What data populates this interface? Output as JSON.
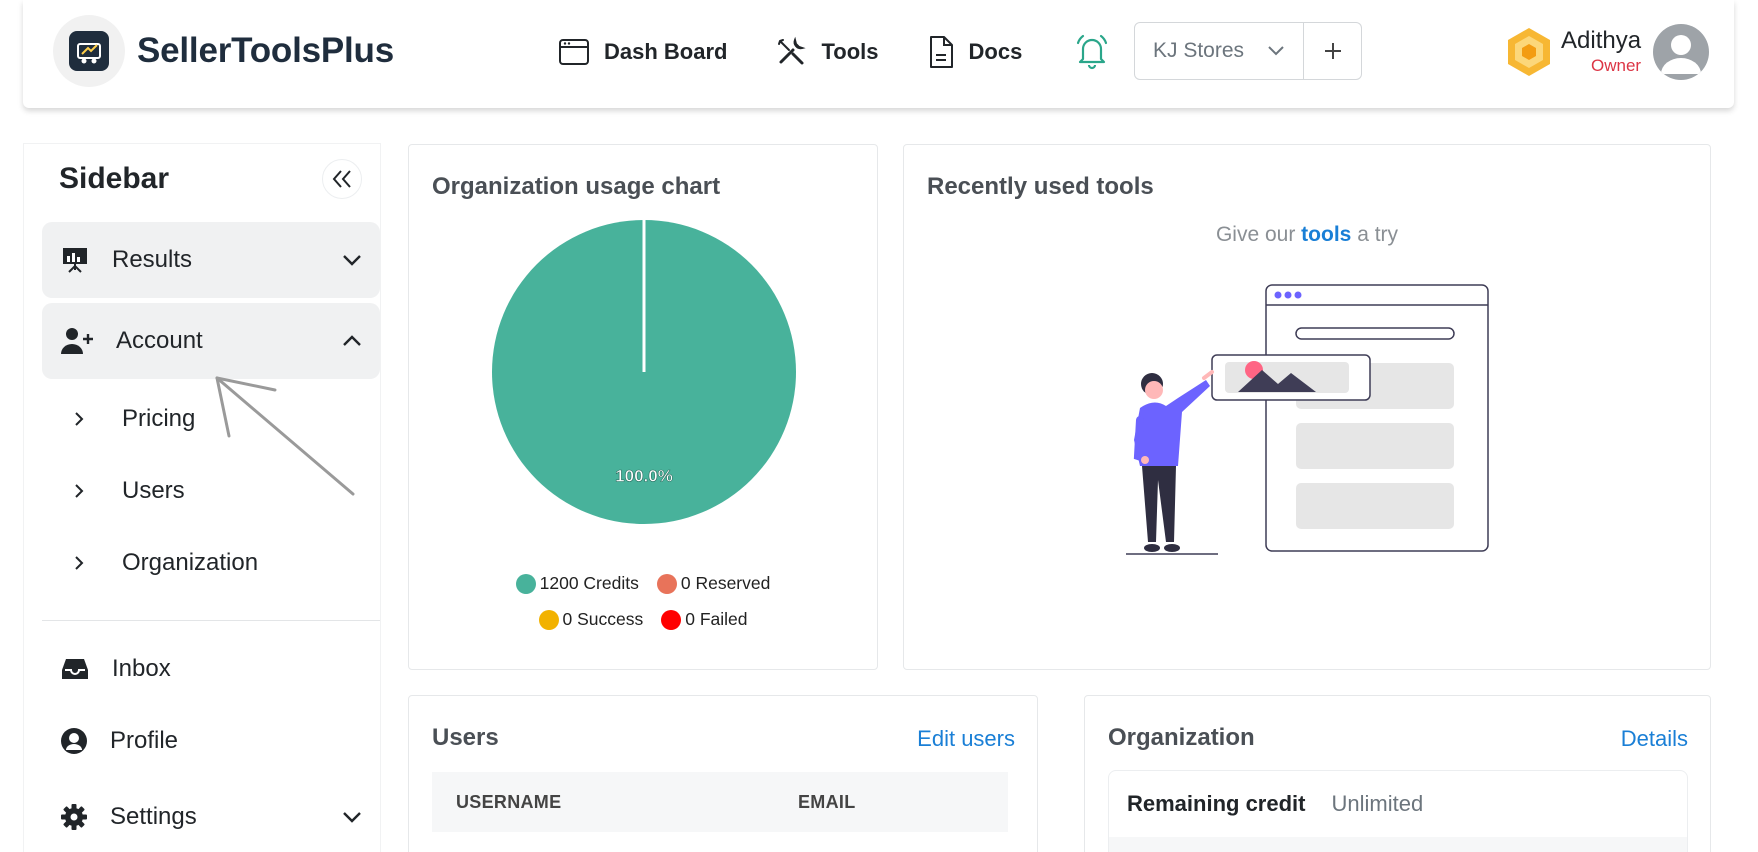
{
  "header": {
    "brand": "SellerToolsPlus",
    "nav": [
      {
        "label": "Dash Board",
        "icon": "browser-window-icon"
      },
      {
        "label": "Tools",
        "icon": "tools-icon"
      },
      {
        "label": "Docs",
        "icon": "document-icon"
      }
    ],
    "bell_icon": "bell-icon",
    "store_select": {
      "value": "KJ Stores"
    },
    "add_label": "+",
    "user": {
      "name": "Adithya",
      "role": "Owner"
    }
  },
  "sidebar": {
    "title": "Sidebar",
    "items": [
      {
        "label": "Results",
        "icon": "presentation-chart-icon",
        "expanded": false
      },
      {
        "label": "Account",
        "icon": "user-plus-icon",
        "expanded": true
      }
    ],
    "sub_items": [
      "Pricing",
      "Users",
      "Organization"
    ],
    "bottom_items": [
      {
        "label": "Inbox",
        "icon": "inbox-icon"
      },
      {
        "label": "Profile",
        "icon": "user-circle-icon"
      },
      {
        "label": "Settings",
        "icon": "gear-icon"
      }
    ]
  },
  "usage_card": {
    "title": "Organization usage chart",
    "chart_data": {
      "type": "pie",
      "categories": [
        "1200 Credits",
        "0 Reserved",
        "0 Success",
        "0 Failed"
      ],
      "values": [
        1200,
        0,
        0,
        0
      ],
      "colors": [
        "#48b29b",
        "#e8735a",
        "#f2b200",
        "#ff0000"
      ],
      "data_labels": [
        "100.0%"
      ],
      "legend": "bottom"
    }
  },
  "recent_card": {
    "title": "Recently used tools",
    "try_prefix": "Give our",
    "try_link": "tools",
    "try_suffix": "a try"
  },
  "users_card": {
    "title": "Users",
    "link": "Edit users",
    "columns": [
      "USERNAME",
      "EMAIL"
    ]
  },
  "org_card": {
    "title": "Organization",
    "link": "Details",
    "rows": [
      {
        "key": "Remaining credit",
        "value": "Unlimited"
      }
    ]
  }
}
